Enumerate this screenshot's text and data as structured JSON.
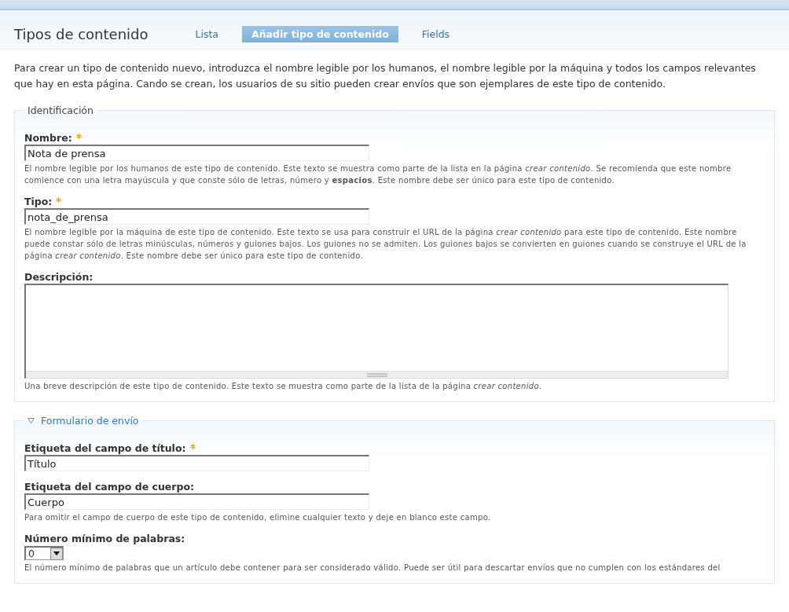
{
  "page_title": "Tipos de contenido",
  "tabs": [
    {
      "label": "Lista",
      "selected": false
    },
    {
      "label": "Añadir tipo de contenido",
      "selected": true
    },
    {
      "label": "Fields",
      "selected": false
    }
  ],
  "intro": "Para crear un tipo de contenido nuevo, introduzca el nombre legible por los humanos, el nombre legible por la máquina y todos los campos relevantes que hay en esta página. Cando se crean, los usuarios de su sitio pueden crear envíos que son ejemplares de este tipo de contenido.",
  "fieldsets": [
    {
      "legend": "Identificación",
      "collapsible": false,
      "fields": [
        {
          "kind": "text",
          "label": "Nombre:",
          "required": true,
          "value": "Nota de prensa",
          "help": "El nombre legible por los humanos de este tipo de contenido. Este texto se muestra como parte de la lista en la página *crear contenido*. Se recomienda que este nombre comience con una letra mayúscula y que conste sólo de letras, número y **espacios**. Este nombre debe ser único para este tipo de contenido."
        },
        {
          "kind": "text",
          "label": "Tipo:",
          "required": true,
          "value": "nota_de_prensa",
          "help": "El nombre legible por la máquina de este tipo de contenido. Este texto se usa para construir el URL de la página *crear contenido* para este tipo de contenido. Este nombre puede constar sólo de letras minúsculas, números y guiones bajos. Los guiones no se admiten. Los guiones bajos se convierten en guiones cuando se construye el URL de la página *crear contenido*. Este nombre debe ser único para este tipo de contenido."
        },
        {
          "kind": "textarea",
          "label": "Descripción:",
          "required": false,
          "help": "Una breve descripción de este tipo de contenido. Este texto se muestra como parte de la lista de la página *crear contenido*."
        }
      ]
    },
    {
      "legend": "Formulario de envío",
      "collapsible": true,
      "fields": [
        {
          "kind": "text",
          "label": "Etiqueta del campo de título:",
          "required": true,
          "value": "Título"
        },
        {
          "kind": "text",
          "label": "Etiqueta del campo de cuerpo:",
          "required": false,
          "value": "Cuerpo",
          "help": "Para omitir el campo de cuerpo de este tipo de contenido, elimine cualquier texto y deje en blanco este campo."
        },
        {
          "kind": "select",
          "label": "Número mínimo de palabras:",
          "required": false,
          "value": "0",
          "help": "El número mínimo de palabras que un artículo debe contener para ser considerado válido. Puede ser útil para descartar envíos que no cumplen con los estándares del"
        }
      ]
    }
  ]
}
